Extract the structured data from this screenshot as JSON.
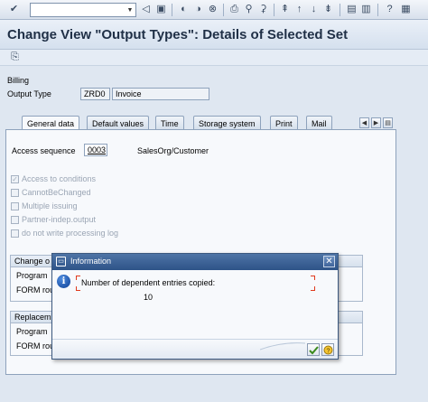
{
  "toolbar": {
    "command_field_value": "",
    "icons": [
      "enter-icon",
      "back-icon",
      "save-icon",
      "shortcut-icons",
      "find-icon",
      "page-icons",
      "session-icons",
      "layout-icon",
      "help-icon",
      "customize-icon"
    ]
  },
  "header": {
    "title": "Change View \"Output Types\": Details of Selected Set"
  },
  "form": {
    "section_label": "Billing",
    "output_type_label": "Output Type",
    "output_type_value": "ZRD0",
    "output_type_desc": "Invoice"
  },
  "tabs": [
    {
      "label": "General data",
      "active": true
    },
    {
      "label": "Default values",
      "active": false
    },
    {
      "label": "Time",
      "active": false
    },
    {
      "label": "Storage system",
      "active": false
    },
    {
      "label": "Print",
      "active": false
    },
    {
      "label": "Mail",
      "active": false
    }
  ],
  "general": {
    "access_sequence_label": "Access sequence",
    "access_sequence_value": "0003",
    "access_sequence_desc": "SalesOrg/Customer",
    "checkboxes": [
      {
        "label": "Access to conditions",
        "checked": true
      },
      {
        "label": "CannotBeChanged",
        "checked": false
      },
      {
        "label": "Multiple issuing",
        "checked": false
      },
      {
        "label": "Partner-indep.output",
        "checked": false
      },
      {
        "label": "do not write processing log",
        "checked": false
      }
    ],
    "group1": {
      "title": "Change o",
      "rows": [
        "Program",
        "FORM rou"
      ]
    },
    "group2": {
      "title": "Replacem",
      "rows": [
        "Program",
        "FORM rou"
      ]
    }
  },
  "dialog": {
    "title": "Information",
    "message": "Number of dependent entries copied:",
    "count": "10"
  },
  "colors": {
    "title_bar": "#2e5388",
    "background": "#dfe7f1",
    "bracket": "#e03a1e"
  }
}
